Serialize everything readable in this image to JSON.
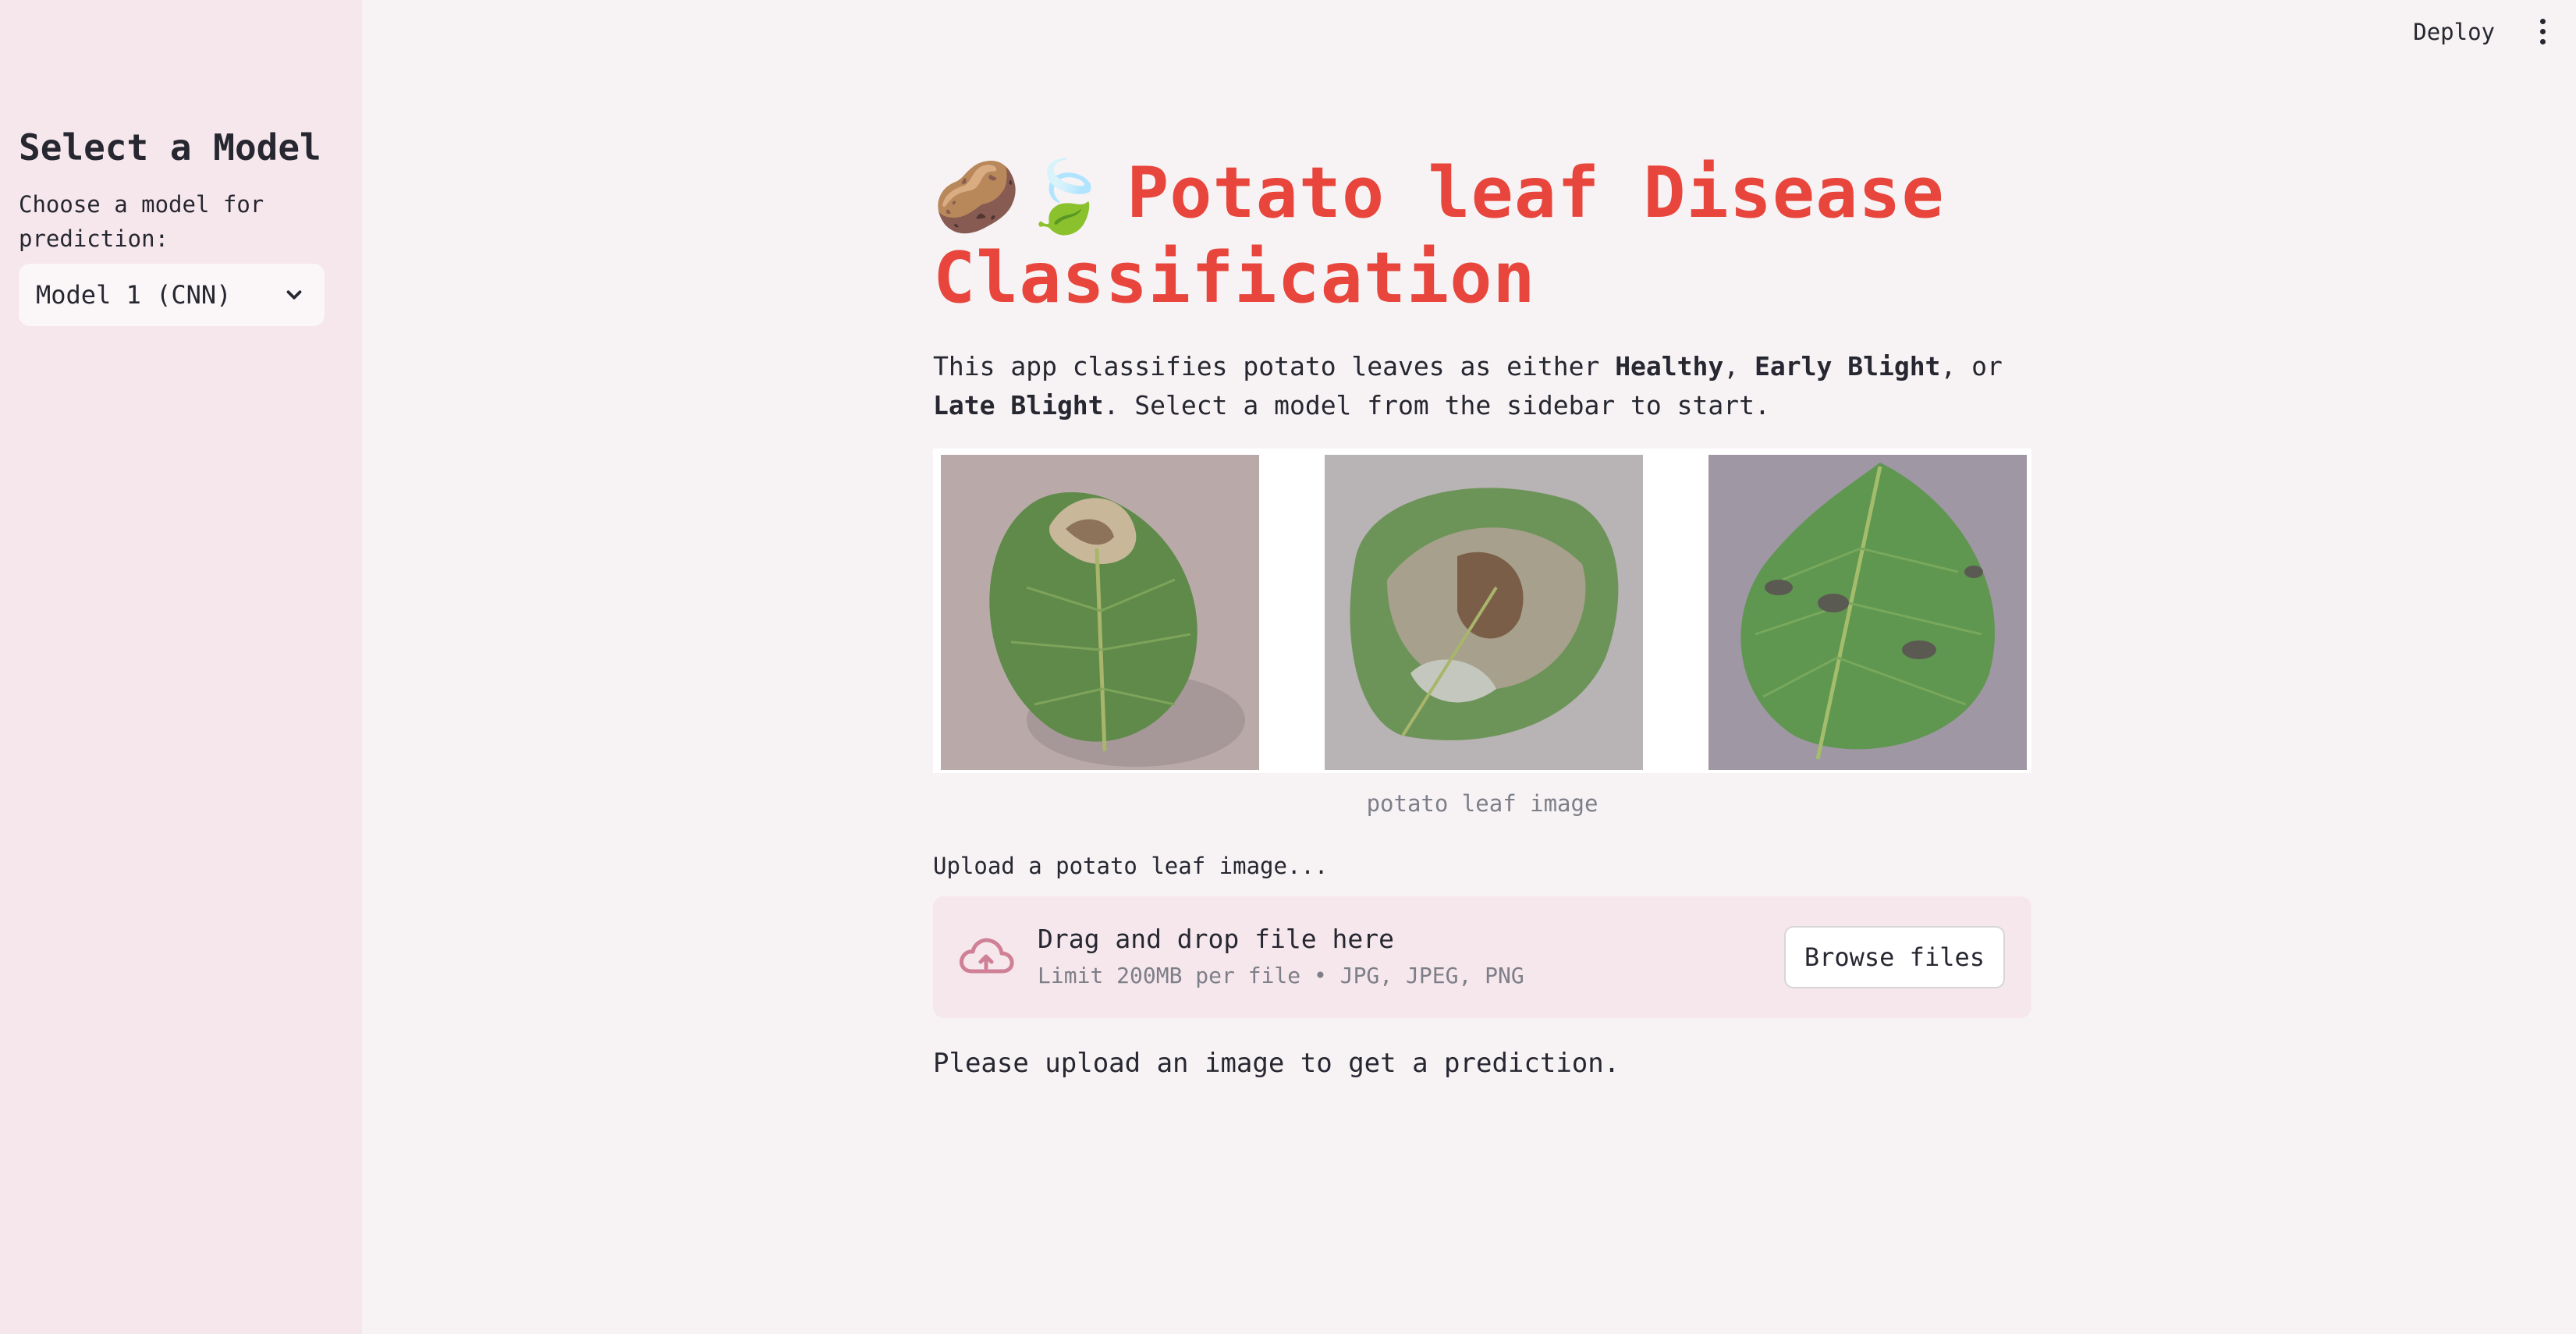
{
  "header": {
    "deploy_label": "Deploy",
    "menu_icon": "vertical-ellipsis-icon"
  },
  "sidebar": {
    "heading": "Select a Model",
    "select_label": "Choose a model for prediction:",
    "selected_model": "Model 1 (CNN)"
  },
  "main": {
    "title_emoji": "🥔🍃",
    "title": "Potato leaf Disease Classification",
    "description": {
      "intro": "This app classifies potato leaves as either ",
      "class_1": "Healthy",
      "sep_1": ", ",
      "class_2": "Early Blight",
      "sep_2": ", or ",
      "class_3": "Late Blight",
      "outro": ". Select a model from the sidebar to start."
    },
    "image_caption": "potato leaf image",
    "upload_label": "Upload a potato leaf image...",
    "dropzone": {
      "title": "Drag and drop file here",
      "limit": "Limit 200MB per file • JPG, JPEG, PNG",
      "browse_label": "Browse files",
      "icon": "cloud-upload-icon"
    },
    "status_message": "Please upload an image to get a prediction."
  },
  "colors": {
    "title": "#e8453c",
    "sidebar_bg": "#f6e7ec",
    "main_bg": "#f7f3f5",
    "upload_icon": "#d08096"
  }
}
